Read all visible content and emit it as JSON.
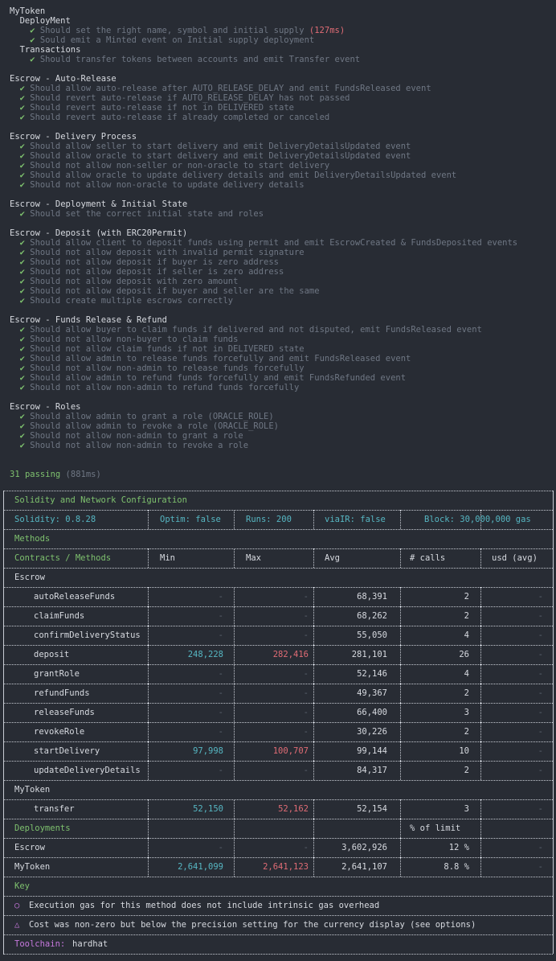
{
  "tests": [
    {
      "type": "suite",
      "indent": 1,
      "text": "MyToken"
    },
    {
      "type": "suite",
      "indent": 3,
      "text": "DeployMent"
    },
    {
      "type": "pass",
      "indent": 5,
      "text": "Should set the right name, symbol and initial supply",
      "duration": "(127ms)"
    },
    {
      "type": "pass",
      "indent": 5,
      "text": "Sould emit a Minted event on Initial supply deployment"
    },
    {
      "type": "suite",
      "indent": 3,
      "text": "Transactions"
    },
    {
      "type": "pass",
      "indent": 5,
      "text": "Should transfer tokens between accounts and emit Transfer event"
    },
    {
      "type": "gap"
    },
    {
      "type": "suite",
      "indent": 1,
      "text": "Escrow - Auto-Release"
    },
    {
      "type": "pass",
      "indent": 3,
      "text": "Should allow auto-release after AUTO_RELEASE_DELAY and emit FundsReleased event"
    },
    {
      "type": "pass",
      "indent": 3,
      "text": "Should revert auto-release if AUTO_RELEASE_DELAY has not passed"
    },
    {
      "type": "pass",
      "indent": 3,
      "text": "Should revert auto-release if not in DELIVERED state"
    },
    {
      "type": "pass",
      "indent": 3,
      "text": "Should revert auto-release if already completed or canceled"
    },
    {
      "type": "gap"
    },
    {
      "type": "suite",
      "indent": 1,
      "text": "Escrow - Delivery Process"
    },
    {
      "type": "pass",
      "indent": 3,
      "text": "Should allow seller to start delivery and emit DeliveryDetailsUpdated event"
    },
    {
      "type": "pass",
      "indent": 3,
      "text": "Should allow oracle to start delivery and emit DeliveryDetailsUpdated event"
    },
    {
      "type": "pass",
      "indent": 3,
      "text": "Should not allow non-seller or non-oracle to start delivery"
    },
    {
      "type": "pass",
      "indent": 3,
      "text": "Should allow oracle to update delivery details and emit DeliveryDetailsUpdated event"
    },
    {
      "type": "pass",
      "indent": 3,
      "text": "Should not allow non-oracle to update delivery details"
    },
    {
      "type": "gap"
    },
    {
      "type": "suite",
      "indent": 1,
      "text": "Escrow - Deployment & Initial State"
    },
    {
      "type": "pass",
      "indent": 3,
      "text": "Should set the correct initial state and roles"
    },
    {
      "type": "gap"
    },
    {
      "type": "suite",
      "indent": 1,
      "text": "Escrow - Deposit (with ERC20Permit)"
    },
    {
      "type": "pass",
      "indent": 3,
      "text": "Should allow client to deposit funds using permit and emit EscrowCreated & FundsDeposited events"
    },
    {
      "type": "pass",
      "indent": 3,
      "text": "Should not allow deposit with invalid permit signature"
    },
    {
      "type": "pass",
      "indent": 3,
      "text": "Should not allow deposit if buyer is zero address"
    },
    {
      "type": "pass",
      "indent": 3,
      "text": "Should not allow deposit if seller is zero address"
    },
    {
      "type": "pass",
      "indent": 3,
      "text": "Should not allow deposit with zero amount"
    },
    {
      "type": "pass",
      "indent": 3,
      "text": "Should not allow deposit if buyer and seller are the same"
    },
    {
      "type": "pass",
      "indent": 3,
      "text": "Should create multiple escrows correctly"
    },
    {
      "type": "gap"
    },
    {
      "type": "suite",
      "indent": 1,
      "text": "Escrow - Funds Release & Refund"
    },
    {
      "type": "pass",
      "indent": 3,
      "text": "Should allow buyer to claim funds if delivered and not disputed, emit FundsReleased event"
    },
    {
      "type": "pass",
      "indent": 3,
      "text": "Should not allow non-buyer to claim funds"
    },
    {
      "type": "pass",
      "indent": 3,
      "text": "Should not allow claim funds if not in DELIVERED state"
    },
    {
      "type": "pass",
      "indent": 3,
      "text": "Should allow admin to release funds forcefully and emit FundsReleased event"
    },
    {
      "type": "pass",
      "indent": 3,
      "text": "Should not allow non-admin to release funds forcefully"
    },
    {
      "type": "pass",
      "indent": 3,
      "text": "Should allow admin to refund funds forcefully and emit FundsRefunded event"
    },
    {
      "type": "pass",
      "indent": 3,
      "text": "Should not allow non-admin to refund funds forcefully"
    },
    {
      "type": "gap"
    },
    {
      "type": "suite",
      "indent": 1,
      "text": "Escrow - Roles"
    },
    {
      "type": "pass",
      "indent": 3,
      "text": "Should allow admin to grant a role (ORACLE_ROLE)"
    },
    {
      "type": "pass",
      "indent": 3,
      "text": "Should allow admin to revoke a role (ORACLE_ROLE)"
    },
    {
      "type": "pass",
      "indent": 3,
      "text": "Should not allow non-admin to grant a role"
    },
    {
      "type": "pass",
      "indent": 3,
      "text": "Should not allow non-admin to revoke a role"
    }
  ],
  "check_glyph": "✔",
  "summary": {
    "label": "31 passing",
    "duration": "(881ms)"
  },
  "gas_report": {
    "config_title": "Solidity and Network Configuration",
    "config": {
      "solidity": "Solidity: 0.8.28",
      "optim": "Optim: false",
      "runs": "Runs: 200",
      "viair": "viaIR: false",
      "block": "Block: 30,000,000 gas"
    },
    "methods_title": "Methods",
    "headers": [
      "Contracts / Methods",
      "Min",
      "Max",
      "Avg",
      "# calls",
      "usd (avg)"
    ],
    "contracts": [
      {
        "name": "Escrow",
        "methods": [
          {
            "name": "autoReleaseFunds",
            "min": "-",
            "max": "-",
            "avg": "68,391",
            "calls": "2",
            "usd": "-"
          },
          {
            "name": "claimFunds",
            "min": "-",
            "max": "-",
            "avg": "68,262",
            "calls": "2",
            "usd": "-"
          },
          {
            "name": "confirmDeliveryStatus",
            "min": "-",
            "max": "-",
            "avg": "55,050",
            "calls": "4",
            "usd": "-"
          },
          {
            "name": "deposit",
            "min": "248,228",
            "max": "282,416",
            "avg": "281,101",
            "calls": "26",
            "usd": "-"
          },
          {
            "name": "grantRole",
            "min": "-",
            "max": "-",
            "avg": "52,146",
            "calls": "4",
            "usd": "-"
          },
          {
            "name": "refundFunds",
            "min": "-",
            "max": "-",
            "avg": "49,367",
            "calls": "2",
            "usd": "-"
          },
          {
            "name": "releaseFunds",
            "min": "-",
            "max": "-",
            "avg": "66,400",
            "calls": "3",
            "usd": "-"
          },
          {
            "name": "revokeRole",
            "min": "-",
            "max": "-",
            "avg": "30,226",
            "calls": "2",
            "usd": "-"
          },
          {
            "name": "startDelivery",
            "min": "97,998",
            "max": "100,707",
            "avg": "99,144",
            "calls": "10",
            "usd": "-"
          },
          {
            "name": "updateDeliveryDetails",
            "min": "-",
            "max": "-",
            "avg": "84,317",
            "calls": "2",
            "usd": "-"
          }
        ]
      },
      {
        "name": "MyToken",
        "methods": [
          {
            "name": "transfer",
            "min": "52,150",
            "max": "52,162",
            "avg": "52,154",
            "calls": "3",
            "usd": "-"
          }
        ]
      }
    ],
    "deployments_title": "Deployments",
    "deployments_limit_header": "% of limit",
    "deployments": [
      {
        "name": "Escrow",
        "min": "-",
        "max": "-",
        "avg": "3,602,926",
        "limit": "12 %",
        "usd": "-"
      },
      {
        "name": "MyToken",
        "min": "2,641,099",
        "max": "2,641,123",
        "avg": "2,641,107",
        "limit": "8.8 %",
        "usd": "-"
      }
    ],
    "key_title": "Key",
    "key": [
      {
        "symbol": "○",
        "text": "Execution gas for this method does not include intrinsic gas overhead"
      },
      {
        "symbol": "△",
        "text": "Cost was non-zero but below the precision setting for the currency display (see options)"
      }
    ],
    "toolchain_label": "Toolchain:",
    "toolchain_value": "hardhat"
  },
  "colors": {
    "background": "#282c34",
    "pass": "#7ec16e",
    "min": "#56b6c2",
    "max": "#e06c75",
    "muted": "#5c6370",
    "toolchain": "#c678dd"
  }
}
